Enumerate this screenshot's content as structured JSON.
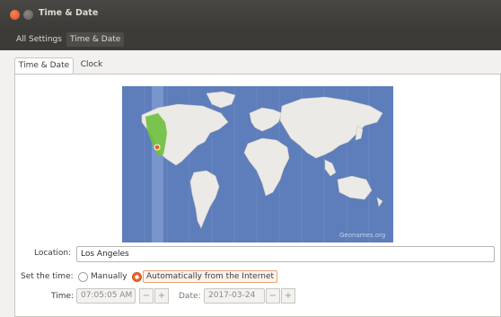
{
  "window": {
    "title": "Time & Date"
  },
  "toolbar": {
    "all_settings": "All Settings",
    "current": "Time & Date"
  },
  "tabs": [
    {
      "label": "Time & Date"
    },
    {
      "label": "Clock"
    }
  ],
  "map": {
    "credit": "Geonames.org",
    "ocean_color": "#5a7ab8",
    "selected_zone_color": "#6fbf3e",
    "marker_color": "#e8642c"
  },
  "location": {
    "label": "Location:",
    "value": "Los Angeles"
  },
  "set_time": {
    "label": "Set the time:",
    "options": [
      {
        "label": "Manually",
        "selected": false
      },
      {
        "label": "Automatically from the Internet",
        "selected": true
      }
    ]
  },
  "time": {
    "label": "Time:",
    "value": "07:05:05 AM",
    "minus": "−",
    "plus": "+"
  },
  "date": {
    "label": "Date:",
    "value": "2017-03-24",
    "minus": "−",
    "plus": "+"
  },
  "colors": {
    "accent": "#e8642c",
    "titlebar": "#3c3b37"
  }
}
